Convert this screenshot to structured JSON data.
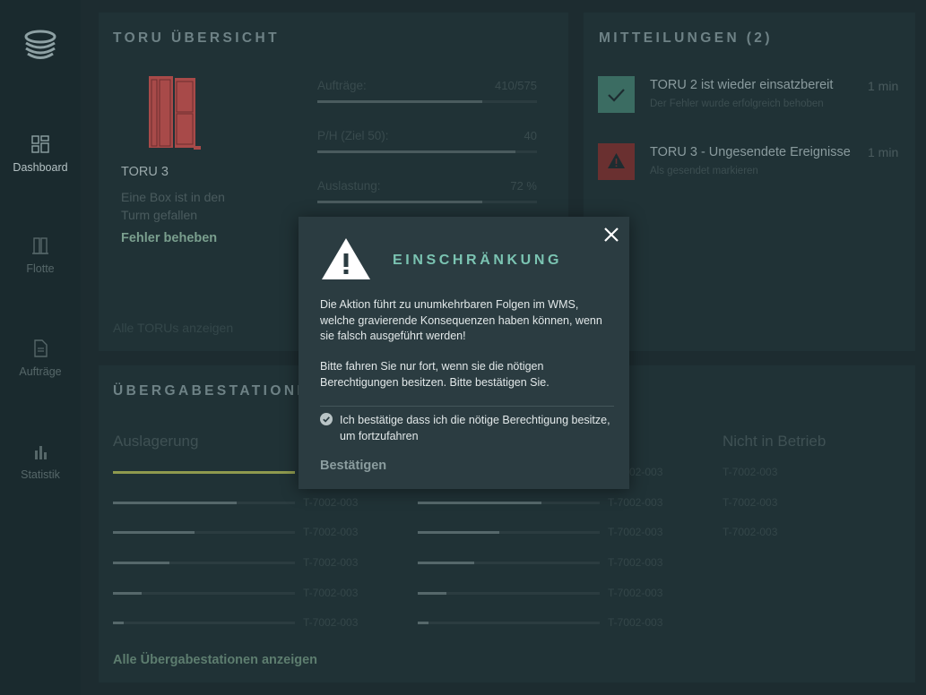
{
  "sidebar": {
    "items": [
      {
        "label": "Dashboard",
        "icon": "dashboard-icon"
      },
      {
        "label": "Flotte",
        "icon": "fleet-icon"
      },
      {
        "label": "Aufträge",
        "icon": "document-icon"
      },
      {
        "label": "Statistik",
        "icon": "chart-icon"
      }
    ]
  },
  "overview": {
    "title": "TORU ÜBERSICHT",
    "robot_name": "TORU 3",
    "status_text": "Eine Box ist in den Turm gefallen",
    "action": "Fehler beheben",
    "show_all": "Alle TORUs anzeigen",
    "metrics": [
      {
        "label": "Aufträge:",
        "value": "410/575",
        "fill": 0.75
      },
      {
        "label": "P/H (Ziel 50):",
        "value": "40",
        "fill": 0.9
      },
      {
        "label": "Auslastung:",
        "value": "72 %",
        "fill": 0.75
      }
    ]
  },
  "notifications": {
    "title": "MITTEILUNGEN (2)",
    "items": [
      {
        "title": "TORU 2 ist wieder einsatzbereit",
        "sub": "Der Fehler wurde erfolgreich behoben",
        "time": "1 min",
        "type": "success",
        "color": "#3b8a78"
      },
      {
        "title": "TORU 3 - Ungesendete Ereignisse",
        "sub": "Als gesendet markieren",
        "time": "1 min",
        "type": "warning",
        "color": "#8e3a3a"
      }
    ]
  },
  "stations": {
    "title": "ÜBERGABESTATIONEN",
    "columns": [
      "Auslagerung",
      "Nicht in Betrieb"
    ],
    "col1": [
      {
        "id": "T-7002-003",
        "fill": 1.0
      },
      {
        "id": "T-7002-003",
        "fill": 0.68
      },
      {
        "id": "T-7002-003",
        "fill": 0.45
      },
      {
        "id": "T-7002-003",
        "fill": 0.31
      },
      {
        "id": "T-7002-003",
        "fill": 0.16
      },
      {
        "id": "T-7002-003",
        "fill": 0.06
      }
    ],
    "col2": [
      {
        "id": "T-7002-003",
        "fill": 1.0
      },
      {
        "id": "T-7002-003",
        "fill": 0.68
      },
      {
        "id": "T-7002-003",
        "fill": 0.45
      },
      {
        "id": "T-7002-003",
        "fill": 0.31
      },
      {
        "id": "T-7002-003",
        "fill": 0.16
      },
      {
        "id": "T-7002-003",
        "fill": 0.06
      }
    ],
    "col3": [
      "T-7002-003",
      "T-7002-003",
      "T-7002-003"
    ],
    "show_all": "Alle Übergabestationen anzeigen"
  },
  "modal": {
    "title": "EINSCHRÄNKUNG",
    "para1": "Die Aktion führt zu unumkehrbaren Folgen im WMS, welche gravierende Konsequenzen haben können, wenn sie falsch ausgeführt werden!",
    "para2": "Bitte fahren Sie nur fort, wenn sie die nötigen Berechtigungen besitzen. Bitte bestätigen Sie.",
    "checkbox_label": "Ich bestätige dass ich die nötige Berechtigung besitze, um fortzufahren",
    "checkbox_checked": true,
    "confirm": "Bestätigen",
    "accent": "#7bc4b2"
  }
}
